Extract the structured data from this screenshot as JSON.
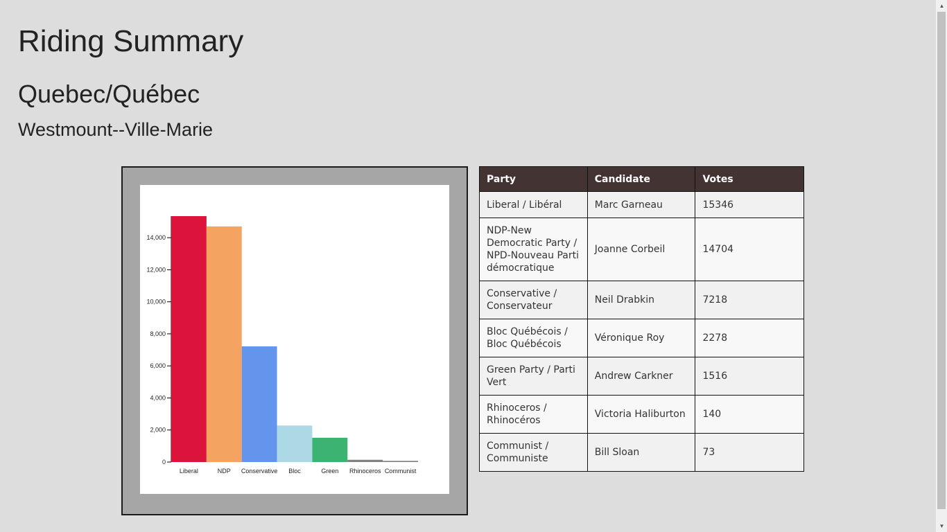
{
  "page": {
    "title": "Riding Summary",
    "province": "Quebec/Québec",
    "riding": "Westmount--Ville-Marie"
  },
  "table": {
    "headers": [
      "Party",
      "Candidate",
      "Votes"
    ],
    "rows": [
      {
        "party": "Liberal / Libéral",
        "candidate": "Marc Garneau",
        "votes": "15346"
      },
      {
        "party": "NDP-New Democratic Party / NPD-Nouveau Parti démocratique",
        "candidate": "Joanne Corbeil",
        "votes": "14704"
      },
      {
        "party": "Conservative / Conservateur",
        "candidate": "Neil Drabkin",
        "votes": "7218"
      },
      {
        "party": "Bloc Québécois / Bloc Québécois",
        "candidate": "Véronique Roy",
        "votes": "2278"
      },
      {
        "party": "Green Party / Parti Vert",
        "candidate": "Andrew Carkner",
        "votes": "1516"
      },
      {
        "party": "Rhinoceros / Rhinocéros",
        "candidate": "Victoria Haliburton",
        "votes": "140"
      },
      {
        "party": "Communist / Communiste",
        "candidate": "Bill Sloan",
        "votes": "73"
      }
    ]
  },
  "chart_data": {
    "type": "bar",
    "categories": [
      "Liberal",
      "NDP",
      "Conservative",
      "Bloc",
      "Green",
      "Rhinoceros",
      "Communist"
    ],
    "values": [
      15346,
      14704,
      7218,
      2278,
      1516,
      140,
      73
    ],
    "colors": [
      "#dc143c",
      "#f4a460",
      "#6495ed",
      "#add8e6",
      "#3cb371",
      "#808080",
      "#808080"
    ],
    "yticks": [
      "0",
      "2,000",
      "4,000",
      "6,000",
      "8,000",
      "10,000",
      "12,000",
      "14,000"
    ],
    "ylim": [
      0,
      15346
    ],
    "title": "",
    "xlabel": "",
    "ylabel": "",
    "grid": false,
    "legend": "none"
  }
}
